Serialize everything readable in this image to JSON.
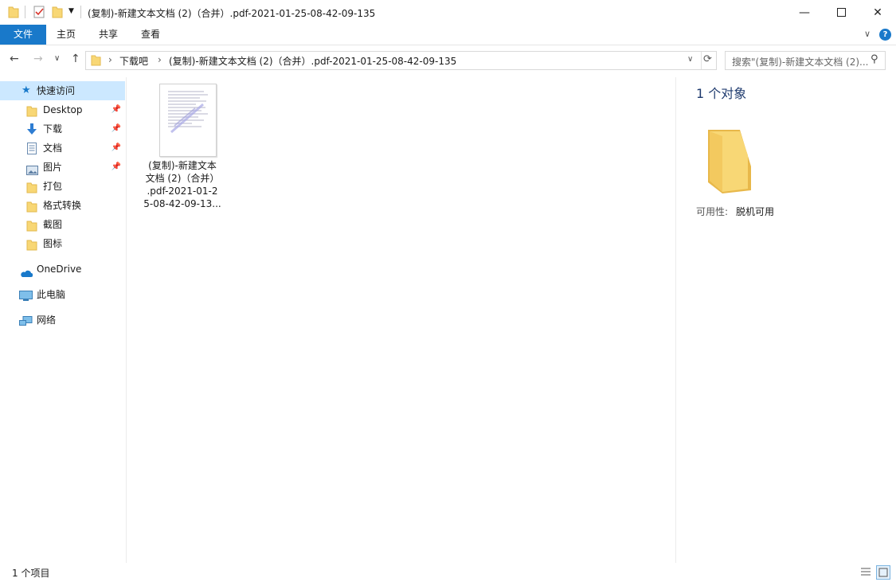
{
  "window": {
    "title": "(复制)-新建文本文档 (2)（合并）.pdf-2021-01-25-08-42-09-135",
    "minimize_glyph": "—",
    "maximize_glyph": "☐",
    "close_glyph": "✕"
  },
  "ribbon": {
    "tabs": [
      {
        "label": "文件"
      },
      {
        "label": "主页"
      },
      {
        "label": "共享"
      },
      {
        "label": "查看"
      }
    ],
    "expand_glyph": "∨",
    "help_glyph": "?"
  },
  "nav": {
    "back_glyph": "←",
    "forward_glyph": "→",
    "recent_glyph": "∨",
    "up_glyph": "↑",
    "breadcrumb": [
      "下载吧",
      "(复制)-新建文本文档 (2)（合并）.pdf-2021-01-25-08-42-09-135"
    ],
    "separator": "›",
    "dropdown_glyph": "∨",
    "refresh_glyph": "⟳",
    "search_placeholder": "搜索\"(复制)-新建文本文档 (2)...",
    "search_glyph": "⚲"
  },
  "sidebar": {
    "quick_access": "快速访问",
    "pinned": [
      {
        "label": "Desktop"
      },
      {
        "label": "下载"
      },
      {
        "label": "文档"
      },
      {
        "label": "图片"
      }
    ],
    "folders": [
      {
        "label": "打包"
      },
      {
        "label": "格式转换"
      },
      {
        "label": "截图"
      },
      {
        "label": "图标"
      }
    ],
    "onedrive": "OneDrive",
    "this_pc": "此电脑",
    "network": "网络",
    "pin_glyph": "📌"
  },
  "content": {
    "file": {
      "name_lines": [
        "(复制)-新建文本",
        "文档 (2)（合并）",
        ".pdf-2021-01-2",
        "5-08-42-09-13..."
      ]
    }
  },
  "details": {
    "count_label": "1 个对象",
    "availability_key": "可用性:",
    "availability_value": "脱机可用"
  },
  "status": {
    "items_count": "1 个项目"
  },
  "colors": {
    "accent": "#1979ca",
    "folder": "#f8d775",
    "folder_dark": "#e8b84a",
    "selected_bg": "#cce8ff"
  }
}
